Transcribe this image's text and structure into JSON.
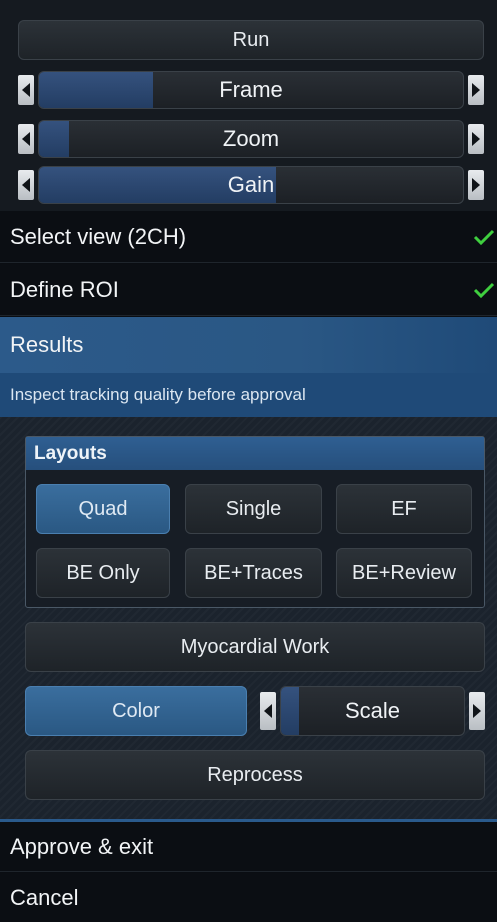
{
  "top_controls": {
    "run_label": "Run",
    "frame": {
      "label": "Frame",
      "level_fraction": 0.27
    },
    "zoom": {
      "label": "Zoom",
      "level_fraction": 0.07
    },
    "gain": {
      "label": "Gain",
      "level_fraction": 0.56
    }
  },
  "steps": [
    {
      "label": "Select view (2CH)",
      "done": true
    },
    {
      "label": "Define ROI",
      "done": true
    },
    {
      "label": "Results",
      "active": true
    }
  ],
  "results": {
    "hint": "Inspect tracking quality before approval",
    "layouts_title": "Layouts",
    "layouts": [
      "Quad",
      "Single",
      "EF",
      "BE Only",
      "BE+Traces",
      "BE+Review"
    ],
    "selected_layout": "Quad",
    "myocardial_work_label": "Myocardial Work",
    "color_label": "Color",
    "scale": {
      "label": "Scale",
      "level_fraction": 0.1
    },
    "reprocess_label": "Reprocess"
  },
  "footer": {
    "approve_label": "Approve & exit",
    "cancel_label": "Cancel"
  },
  "colors": {
    "accent": "#2a5a8c",
    "check": "#3fcf3f",
    "background": "#0a0d12"
  }
}
